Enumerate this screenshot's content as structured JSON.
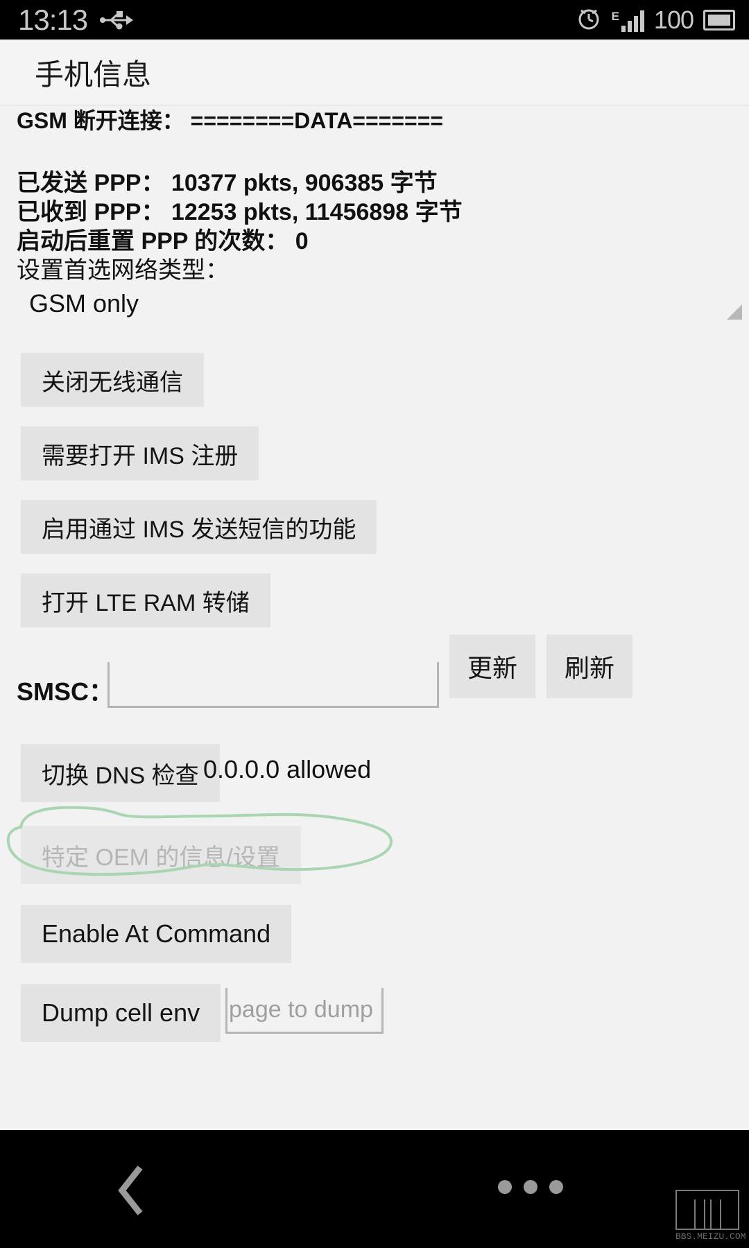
{
  "status_bar": {
    "time": "13:13",
    "usb_icon": "usb-icon",
    "alarm_icon": "alarm-clock-icon",
    "network_type": "E",
    "battery_percent": "100"
  },
  "action_bar": {
    "title": "手机信息"
  },
  "info": {
    "gsm_connection": "GSM 断开连接： ========DATA=======",
    "ppp_sent": "已发送 PPP： 10377 pkts, 906385 字节",
    "ppp_received": "已收到 PPP： 12253 pkts, 11456898 字节",
    "ppp_resets": "启动后重置 PPP 的次数： 0",
    "preferred_network_label": "设置首选网络类型："
  },
  "network_spinner": {
    "selected": "GSM only"
  },
  "buttons": {
    "radio_off": "关闭无线通信",
    "ims_registration": "需要打开 IMS 注册",
    "ims_sms": "启用通过 IMS 发送短信的功能",
    "lte_ram_dump": "打开 LTE RAM 转储",
    "smsc_update": "更新",
    "smsc_refresh": "刷新",
    "dns_check": "切换 DNS 检查",
    "oem_info": "特定 OEM 的信息/设置",
    "enable_at_command": "Enable At Command",
    "dump_cell_env": "Dump cell env"
  },
  "smsc": {
    "label": "SMSC：",
    "value": "",
    "placeholder": ""
  },
  "dns": {
    "status": "0.0.0.0 allowed"
  },
  "dump": {
    "value": "",
    "placeholder": "page to dump"
  },
  "nav_bar": {
    "back_icon": "back-chevron-icon",
    "menu_icon": "overflow-menu-icon"
  },
  "watermark": {
    "text": "BBS.MEIZU.COM"
  },
  "colors": {
    "annotation_green": "#a9d5b2",
    "background": "#f2f2f2",
    "button_face": "#e3e3e3",
    "status_bar": "#000000"
  }
}
